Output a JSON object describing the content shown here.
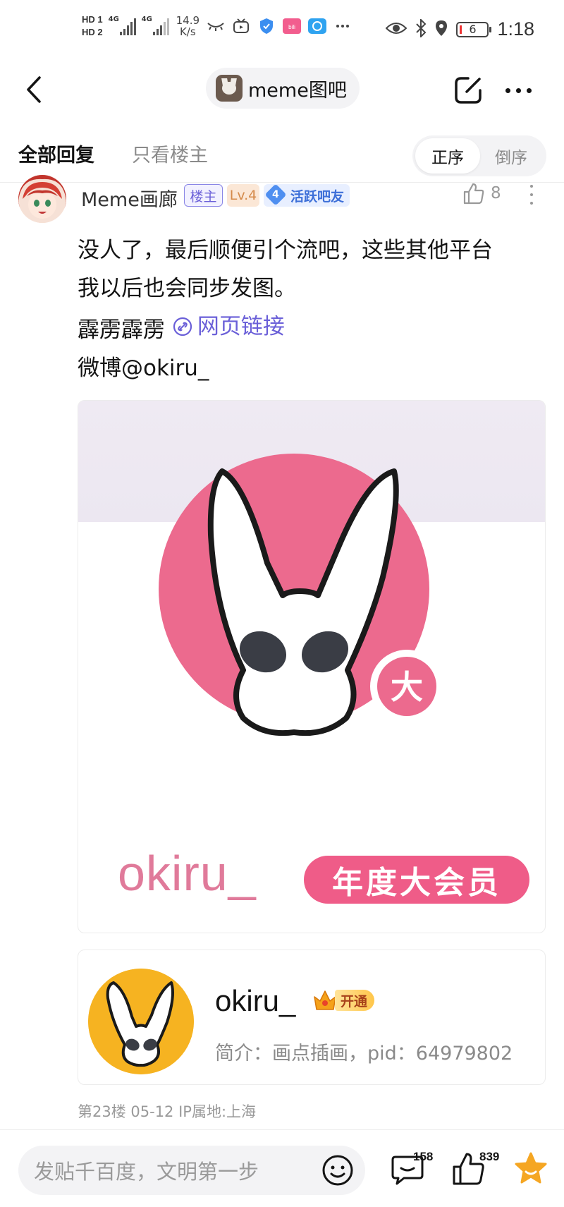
{
  "status_bar": {
    "sim1": "HD 1",
    "sim2": "HD 2",
    "network1": "4G",
    "network2": "4G",
    "speed_value": "14.9",
    "speed_unit": "K/s",
    "battery": "6",
    "time": "1:18"
  },
  "nav": {
    "forum_name": "meme图吧"
  },
  "tabs": {
    "all_replies": "全部回复",
    "host_only": "只看楼主",
    "sort_asc": "正序",
    "sort_desc": "倒序"
  },
  "post": {
    "user_name": "Meme画廊",
    "badge_host": "楼主",
    "badge_level": "Lv.4",
    "badge_active_num": "4",
    "badge_active": "活跃吧友",
    "like_count": "8",
    "lines": [
      "没人了，最后顺便引个流吧，这些其他平台",
      "我以后也会同步发图。",
      "霹雳霹雳"
    ],
    "link_text": "网页链接",
    "weibo_line": "微博@okiru_",
    "image_caption_name": "okiru_",
    "image_caption_vip": "年度大会员",
    "profile_card": {
      "name": "okiru_",
      "open_label": "开通",
      "bio": "简介：画点插画，pid：64979802"
    },
    "meta": "第23楼  05-12  IP属地:上海"
  },
  "bottom_bar": {
    "input_placeholder": "发贴千百度，文明第一步",
    "comment_count": "158",
    "like_count": "839"
  },
  "colors": {
    "accent_purple": "#6a5fd8",
    "brand_pink": "#ef5c88",
    "star_orange": "#f5a623",
    "avatar_yellow": "#f6b321"
  }
}
